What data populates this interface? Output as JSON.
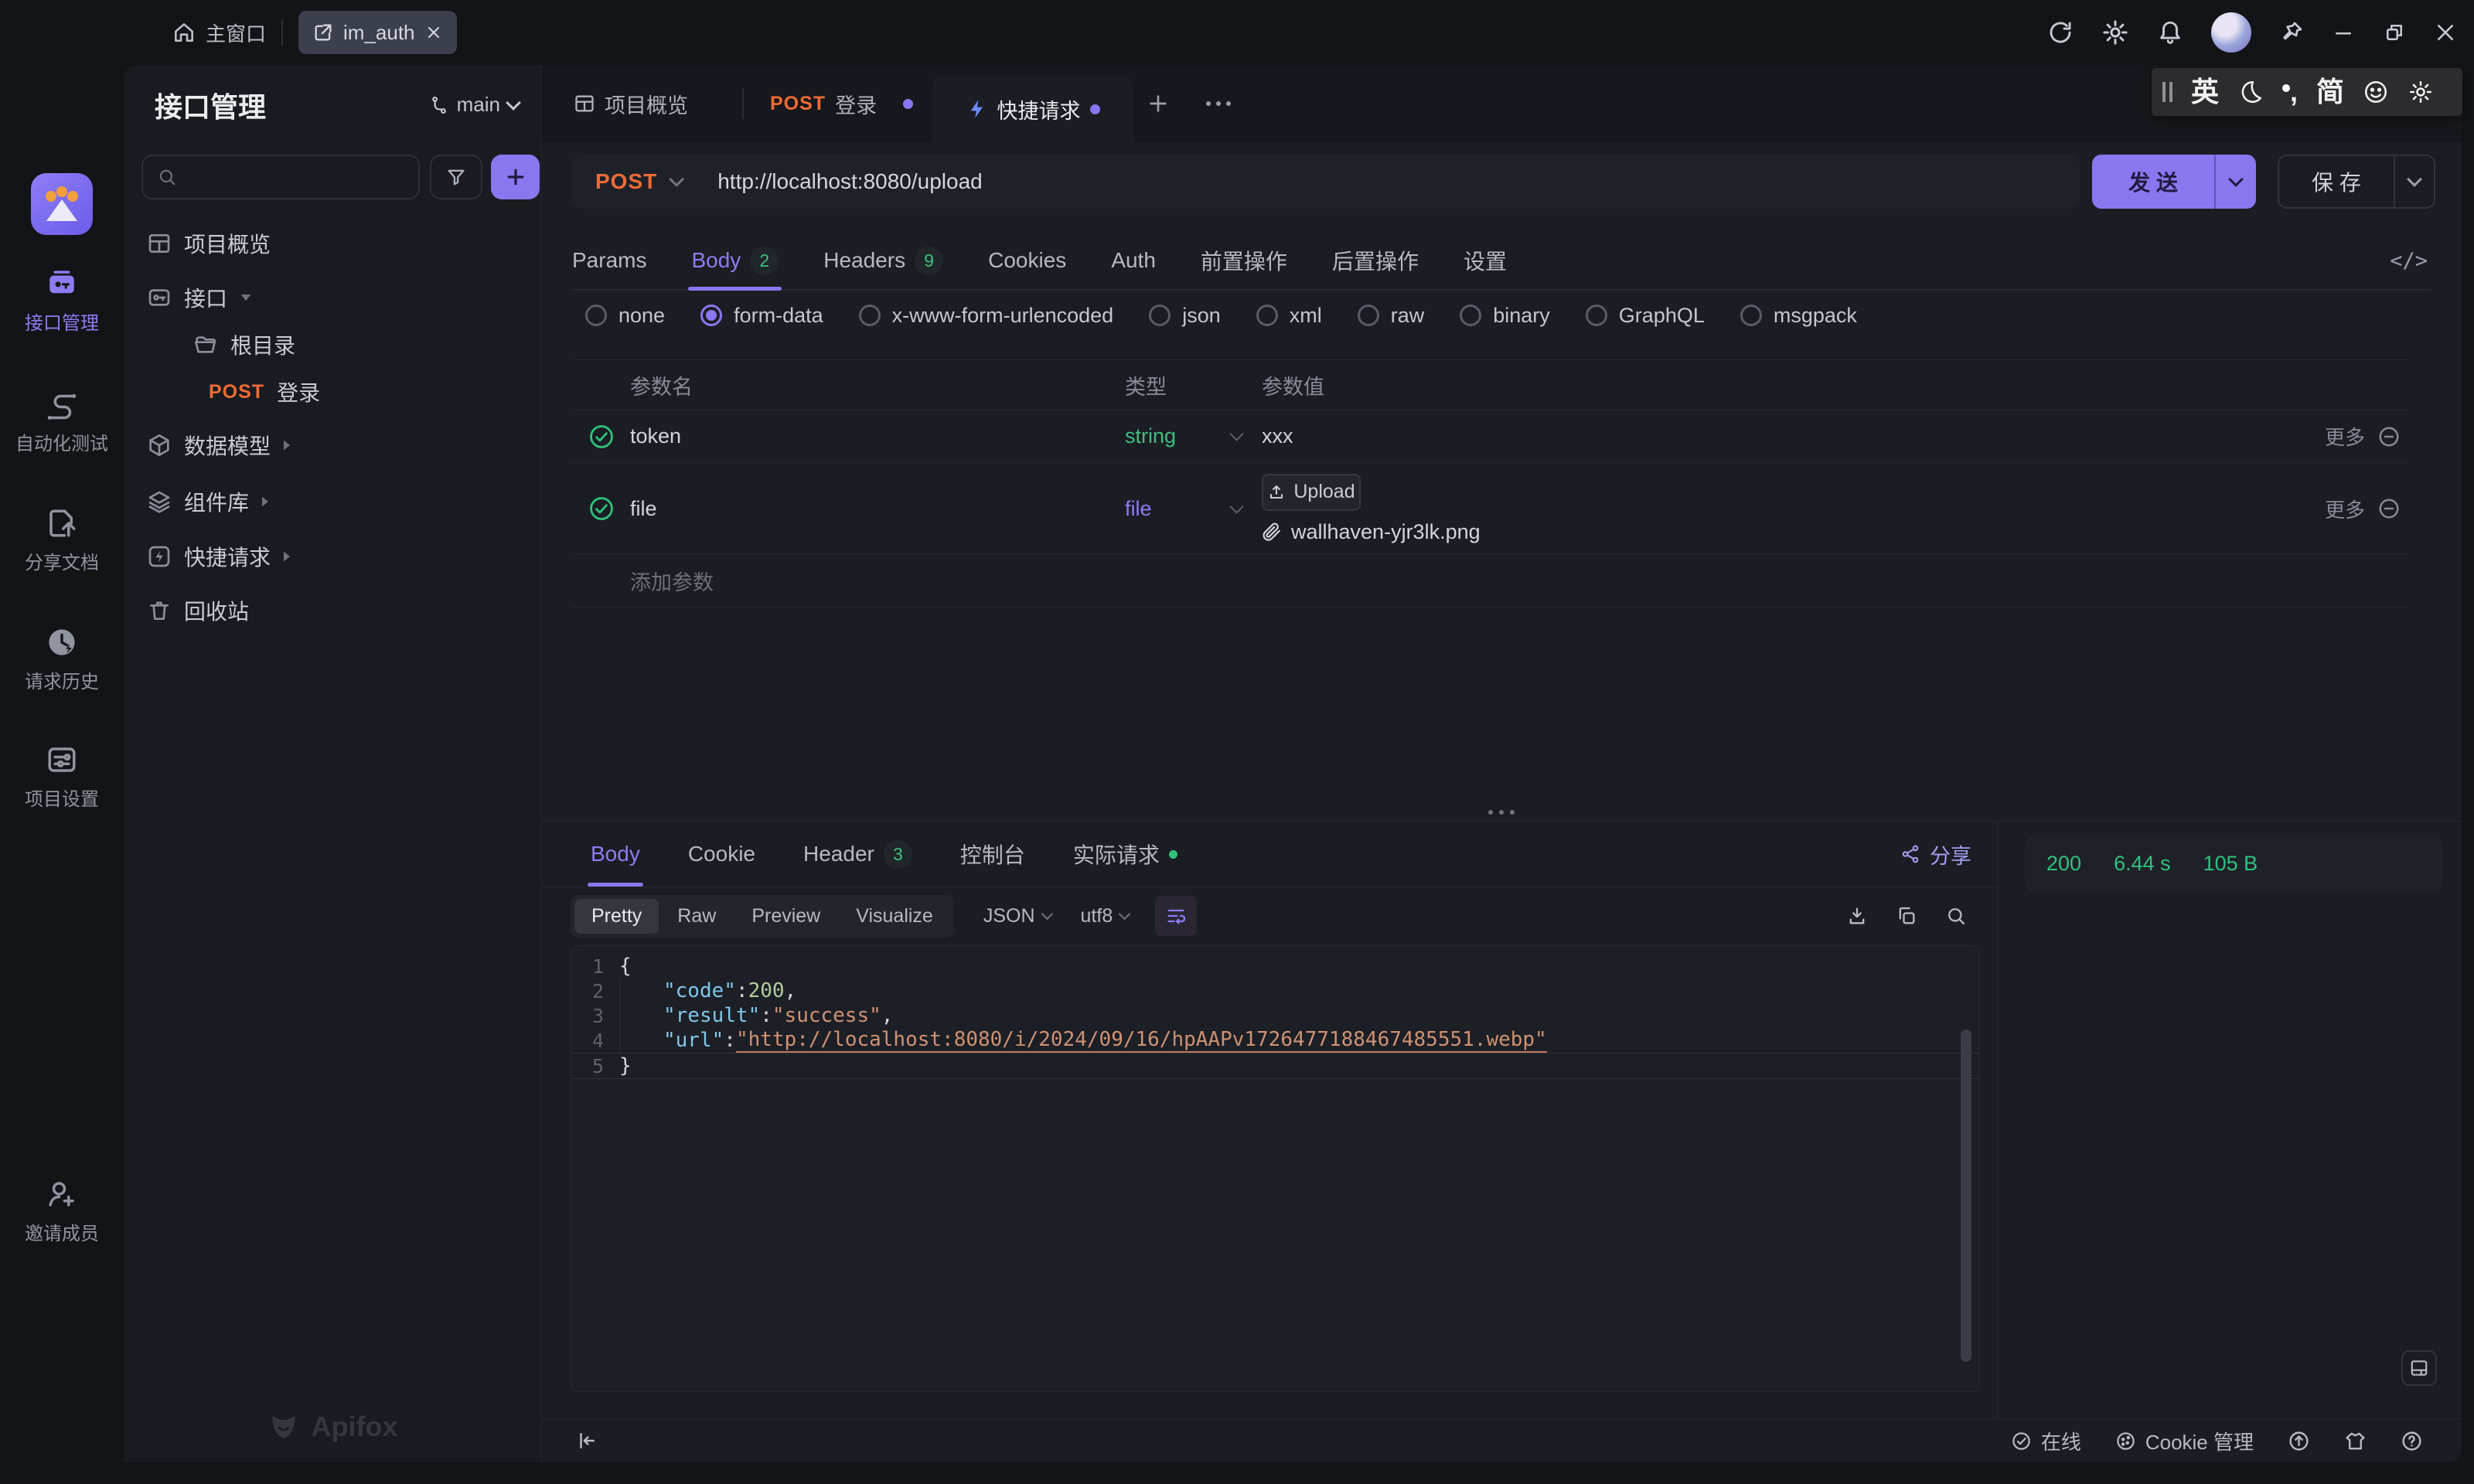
{
  "titlebar": {
    "home": "主窗口",
    "tab": "im_auth"
  },
  "ime": {
    "en": "英",
    "comma": ",",
    "simp": "简"
  },
  "rail": {
    "items": [
      "接口管理",
      "自动化测试",
      "分享文档",
      "请求历史",
      "项目设置"
    ],
    "invite": "邀请成员",
    "brand": "Apifox"
  },
  "sidebar": {
    "title": "接口管理",
    "branch": "main",
    "tree": {
      "overview": "项目概览",
      "api": "接口",
      "root": "根目录",
      "method": "POST",
      "login": "登录",
      "model": "数据模型",
      "components": "组件库",
      "quick": "快捷请求",
      "recycle": "回收站"
    }
  },
  "doc_tabs": {
    "overview": "项目概览",
    "login_method": "POST",
    "login": "登录",
    "quick": "快捷请求"
  },
  "request": {
    "method": "POST",
    "url": "http://localhost:8080/upload",
    "send": "发 送",
    "save": "保 存",
    "tabs": [
      "Params",
      "Body",
      "Headers",
      "Cookies",
      "Auth",
      "前置操作",
      "后置操作",
      "设置"
    ],
    "body_badge": "2",
    "headers_badge": "9",
    "code_icon": "</>",
    "body_types": [
      "none",
      "form-data",
      "x-www-form-urlencoded",
      "json",
      "xml",
      "raw",
      "binary",
      "GraphQL",
      "msgpack"
    ],
    "table": {
      "col_name": "参数名",
      "col_type": "类型",
      "col_value": "参数值",
      "row1": {
        "name": "token",
        "type": "string",
        "value": "xxx",
        "more": "更多"
      },
      "row2": {
        "name": "file",
        "type": "file",
        "upload": "Upload",
        "filename": "wallhaven-yjr3lk.png",
        "more": "更多"
      },
      "add": "添加参数"
    }
  },
  "response": {
    "tab_body": "Body",
    "tab_cookie": "Cookie",
    "tab_header": "Header",
    "header_badge": "3",
    "tab_console": "控制台",
    "tab_actual": "实际请求",
    "share": "分享",
    "status_code": "200",
    "status_time": "6.44 s",
    "status_size": "105 B",
    "modes": [
      "Pretty",
      "Raw",
      "Preview",
      "Visualize"
    ],
    "format": "JSON",
    "encoding": "utf8",
    "code": {
      "n1": "1",
      "n2": "2",
      "n3": "3",
      "n4": "4",
      "n5": "5",
      "l1": "{",
      "k2": "\"code\"",
      "s2": ": ",
      "v2": "200",
      "c2": ",",
      "k3": "\"result\"",
      "s3": ": ",
      "v3": "\"success\"",
      "c3": ",",
      "k4": "\"url\"",
      "s4": ": ",
      "v4": "\"http://localhost:8080/i/2024/09/16/hpAAPv1726477188467485551.webp\"",
      "l5": "}"
    }
  },
  "statusbar": {
    "online": "在线",
    "cookie": "Cookie 管理"
  }
}
